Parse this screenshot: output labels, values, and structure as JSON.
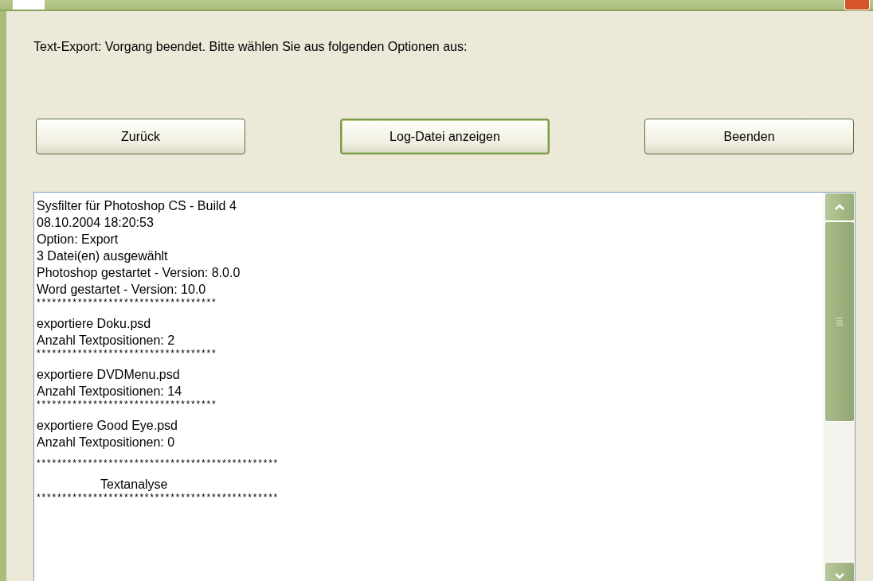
{
  "message": "Text-Export: Vorgang beendet. Bitte wählen Sie aus folgenden Optionen aus:",
  "buttons": [
    {
      "label": "Zurück",
      "default": false
    },
    {
      "label": "Log-Datei anzeigen",
      "default": true
    },
    {
      "label": "Beenden",
      "default": false
    }
  ],
  "log_blocks": [
    [
      {
        "kind": "text",
        "text": "Sysfilter für Photoshop CS - Build 4"
      },
      {
        "kind": "text",
        "text": "08.10.2004 18:20:53"
      },
      {
        "kind": "text",
        "text": "Option: Export"
      },
      {
        "kind": "text",
        "text": "3 Datei(en) ausgewählt"
      },
      {
        "kind": "text",
        "text": "Photoshop gestartet - Version: 8.0.0"
      },
      {
        "kind": "text",
        "text": "Word gestartet - Version: 10.0"
      },
      {
        "kind": "rule",
        "text": "***********************************"
      }
    ],
    [
      {
        "kind": "text",
        "text": "exportiere Doku.psd"
      },
      {
        "kind": "text",
        "text": "Anzahl Textpositionen: 2"
      },
      {
        "kind": "rule",
        "text": "***********************************"
      }
    ],
    [
      {
        "kind": "text",
        "text": "exportiere DVDMenu.psd"
      },
      {
        "kind": "text",
        "text": "Anzahl Textpositionen: 14"
      },
      {
        "kind": "rule",
        "text": "***********************************"
      }
    ],
    [
      {
        "kind": "text",
        "text": "exportiere Good Eye.psd"
      },
      {
        "kind": "text",
        "text": "Anzahl Textpositionen: 0"
      }
    ],
    [
      {
        "kind": "rule",
        "text": "***********************************************"
      }
    ],
    [
      {
        "kind": "heading",
        "text": "Textanalyse"
      },
      {
        "kind": "rule",
        "text": "***********************************************"
      }
    ]
  ]
}
